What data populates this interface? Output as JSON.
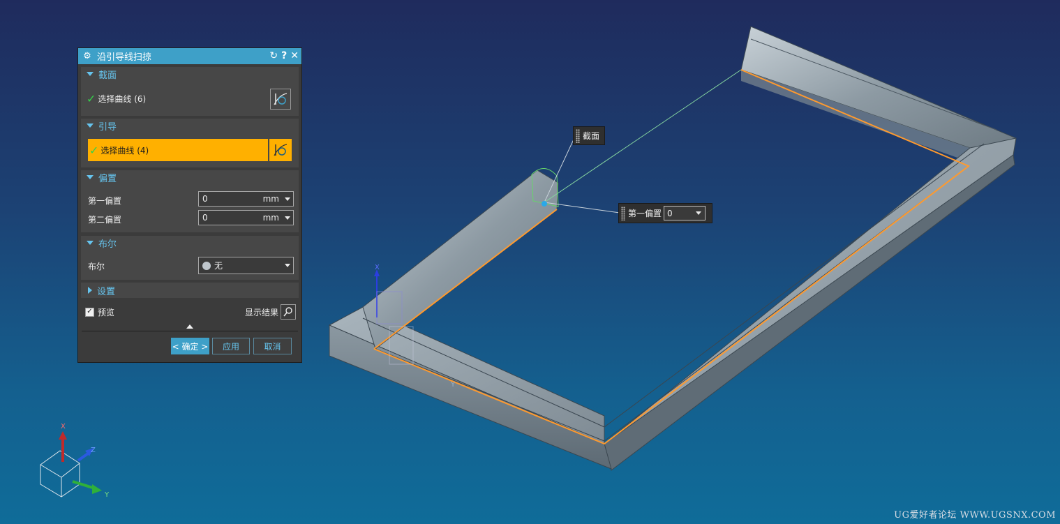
{
  "dialog": {
    "title": "沿引导线扫掠",
    "sections": {
      "section": {
        "header": "截面",
        "select_label": "选择曲线 (6)"
      },
      "guide": {
        "header": "引导",
        "select_label": "选择曲线 (4)"
      },
      "offset": {
        "header": "偏置",
        "first_label": "第一偏置",
        "first_value": "0",
        "first_unit": "mm",
        "second_label": "第二偏置",
        "second_value": "0",
        "second_unit": "mm"
      },
      "boolean": {
        "header": "布尔",
        "label": "布尔",
        "value": "无"
      },
      "settings": {
        "header": "设置"
      }
    },
    "preview_label": "预览",
    "show_result_label": "显示结果",
    "buttons": {
      "ok": "< 确定 >",
      "apply": "应用",
      "cancel": "取消"
    }
  },
  "callouts": {
    "section": "截面",
    "offset_label": "第一偏置",
    "offset_value": "0"
  },
  "triad": {
    "x": "X",
    "y": "Y",
    "z": "Z"
  },
  "wcs": {
    "x": "X",
    "y": "Y"
  },
  "watermark": "UG爱好者论坛 WWW.UGSNX.COM",
  "colors": {
    "accent": "#3ea0c8",
    "highlight": "#ffb000",
    "curve": "#ff9a2e",
    "check": "#35d24a"
  }
}
